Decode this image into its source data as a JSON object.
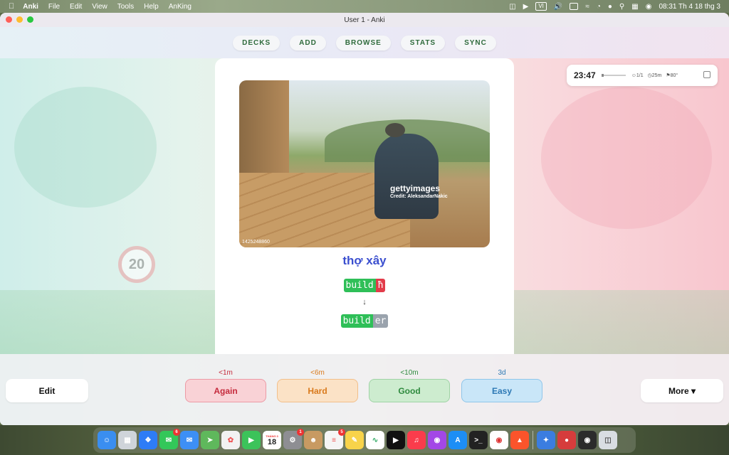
{
  "menubar": {
    "app": "Anki",
    "items": [
      "File",
      "Edit",
      "View",
      "Tools",
      "Help",
      "AnKing"
    ],
    "input_source": "VI",
    "clock": "08:31 Th 4 18 thg 3"
  },
  "window": {
    "title": "User 1 - Anki"
  },
  "toolbar": {
    "buttons": [
      "DECKS",
      "ADD",
      "BROWSE",
      "STATS",
      "SYNC"
    ]
  },
  "timer": {
    "time": "23:47",
    "cards": "1/1",
    "duration": "25m",
    "goal": "80°"
  },
  "background": {
    "sign_number": "20"
  },
  "card": {
    "photo": {
      "watermark": "gettyimages",
      "credit": "Credit: AleksandarNakic",
      "image_id": "1425248860"
    },
    "word": "thợ xây",
    "morph1": {
      "base": "build",
      "suffix": "ħ"
    },
    "arrow": "↓",
    "morph2": {
      "base": "build",
      "suffix": "er"
    }
  },
  "answer": {
    "edit": "Edit",
    "more": "More ▾",
    "buttons": [
      {
        "label": "Again",
        "interval": "<1m"
      },
      {
        "label": "Hard",
        "interval": "<6m"
      },
      {
        "label": "Good",
        "interval": "<10m"
      },
      {
        "label": "Easy",
        "interval": "3d"
      }
    ]
  },
  "dock": {
    "calendar_month": "THÁNG 3",
    "calendar_day": "18",
    "badges": {
      "messages": "6",
      "settings": "1",
      "reminders": "5"
    },
    "colors": {
      "finder": "#3a8ef0",
      "launchpad": "#cfd4da",
      "safari": "#2e7cf6",
      "messages": "#33c759",
      "mail": "#3d8ff5",
      "maps": "#5fb85c",
      "photos": "#f2f2f2",
      "facetime": "#3cc35a",
      "calendar": "#ffffff",
      "settings": "#8e8e93",
      "contacts": "#c89a62",
      "reminders": "#f5f5f5",
      "notes": "#f8d34a",
      "freeform": "#ffffff",
      "tv": "#111111",
      "music": "#fa3c4c",
      "podcasts": "#a347e6",
      "appstore": "#1d8ef5",
      "terminal": "#222222",
      "chrome": "#ffffff",
      "brave": "#fb542b",
      "unknown1": "#3b7de0",
      "photobooth": "#d63c3c",
      "obs": "#2b2b2b",
      "trash": "#d9dde2"
    }
  }
}
